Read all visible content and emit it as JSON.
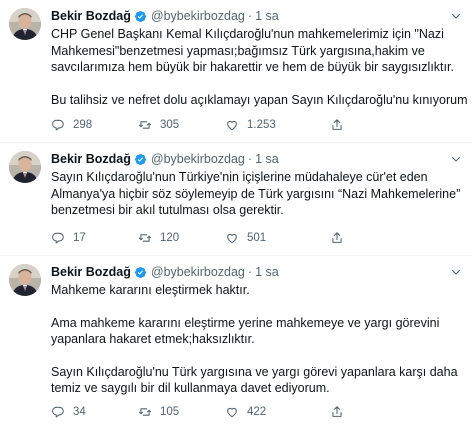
{
  "colors": {
    "text": "#0f1419",
    "secondary": "#536471",
    "verified": "#1d9bf0",
    "divider": "#eff3f4"
  },
  "tweets": [
    {
      "author": "Bekir Bozdağ",
      "handle": "@bybekirbozdag",
      "separator": "·",
      "time": "1 sa",
      "lines": [
        "CHP Genel Başkanı Kemal Kılıçdaroğlu'nun mahkemelerimiz için \"Nazi",
        "Mahkemesi\"benzetmesi yapması;bağımsız Türk yargısına,hakim ve",
        "savcılarımıza hem büyük bir hakarettir ve hem de büyük bir saygısızlıktır.",
        "",
        "Bu talihsiz ve nefret dolu açıklamayı yapan Sayın Kılıçdaroğlu'nu kınıyorum"
      ],
      "replies": "298",
      "retweets": "305",
      "likes": "1.253"
    },
    {
      "author": "Bekir Bozdağ",
      "handle": "@bybekirbozdag",
      "separator": "·",
      "time": "1 sa",
      "lines": [
        "Sayın Kılıçdaroğlu'nun Türkiye'nin içişlerine müdahaleye cür'et eden",
        "Almanya'ya hiçbir söz söylemeyip de Türk yargısını “Nazi Mahkemelerine”",
        "benzetmesi bir akıl tutulması olsa gerektir."
      ],
      "replies": "17",
      "retweets": "120",
      "likes": "501"
    },
    {
      "author": "Bekir Bozdağ",
      "handle": "@bybekirbozdag",
      "separator": "·",
      "time": "1 sa",
      "lines": [
        "Mahkeme kararını eleştirmek haktır.",
        "",
        "Ama mahkeme kararını eleştirme yerine mahkemeye ve yargı görevini",
        "yapanlara hakaret etmek;haksızlıktır.",
        "",
        "Sayın Kılıçdaroğlu'nu Türk yargısına ve yargı görevi yapanlara karşı daha",
        "temiz ve saygılı bir dil kullanmaya davet ediyorum."
      ],
      "replies": "34",
      "retweets": "105",
      "likes": "422"
    }
  ]
}
